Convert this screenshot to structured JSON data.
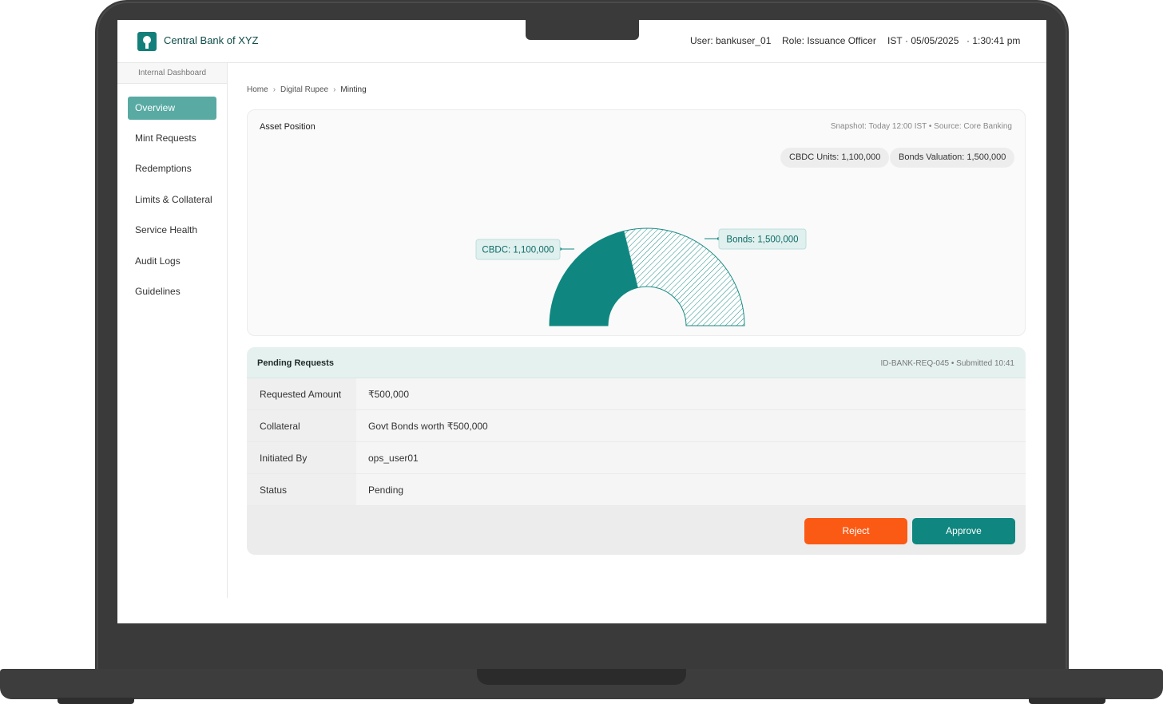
{
  "header": {
    "brand": "Central Bank of XYZ",
    "user": "User: bankuser_01",
    "role": "Role: Issuance Officer",
    "timezone": "IST",
    "date": "· 05/05/2025",
    "time": "· 1:30:41 pm"
  },
  "sidebar": {
    "caption": "Internal Dashboard",
    "items": [
      {
        "label": "Overview",
        "active": true
      },
      {
        "label": "Mint Requests"
      },
      {
        "label": "Redemptions"
      },
      {
        "label": "Limits & Collateral"
      },
      {
        "label": "Service Health"
      },
      {
        "label": "Audit Logs"
      },
      {
        "label": "Guidelines"
      }
    ]
  },
  "breadcrumb": {
    "items": [
      "Home",
      "Digital Rupee",
      "Minting"
    ]
  },
  "asset_position": {
    "title": "Asset Position",
    "meta": "Snapshot: Today 12:00 IST  •  Source: Core Banking",
    "pill_cbdc": "CBDC Units: 1,100,000",
    "pill_bonds": "Bonds Valuation: 1,500,000"
  },
  "chart_data": {
    "type": "pie",
    "variant": "half-donut",
    "categories": [
      "CBDC",
      "Bonds"
    ],
    "values": [
      1100000,
      1500000
    ],
    "labels": [
      "CBDC: 1,100,000",
      "Bonds: 1,500,000"
    ],
    "colors": [
      "#0f8780",
      "#b9dcd8"
    ]
  },
  "pending_requests": {
    "title": "Pending Requests",
    "meta": "ID-BANK-REQ-045  •  Submitted 10:41",
    "rows": [
      {
        "key": "Requested Amount",
        "value": "₹500,000"
      },
      {
        "key": "Collateral",
        "value": "Govt Bonds worth ₹500,000"
      },
      {
        "key": "Initiated By",
        "value": "ops_user01"
      },
      {
        "key": "Status",
        "value": "Pending"
      }
    ],
    "reject_label": "Reject",
    "approve_label": "Approve"
  },
  "colors": {
    "accent": "#0f8780",
    "sidebar_active": "#58aaa3",
    "reject": "#fb5a14"
  }
}
